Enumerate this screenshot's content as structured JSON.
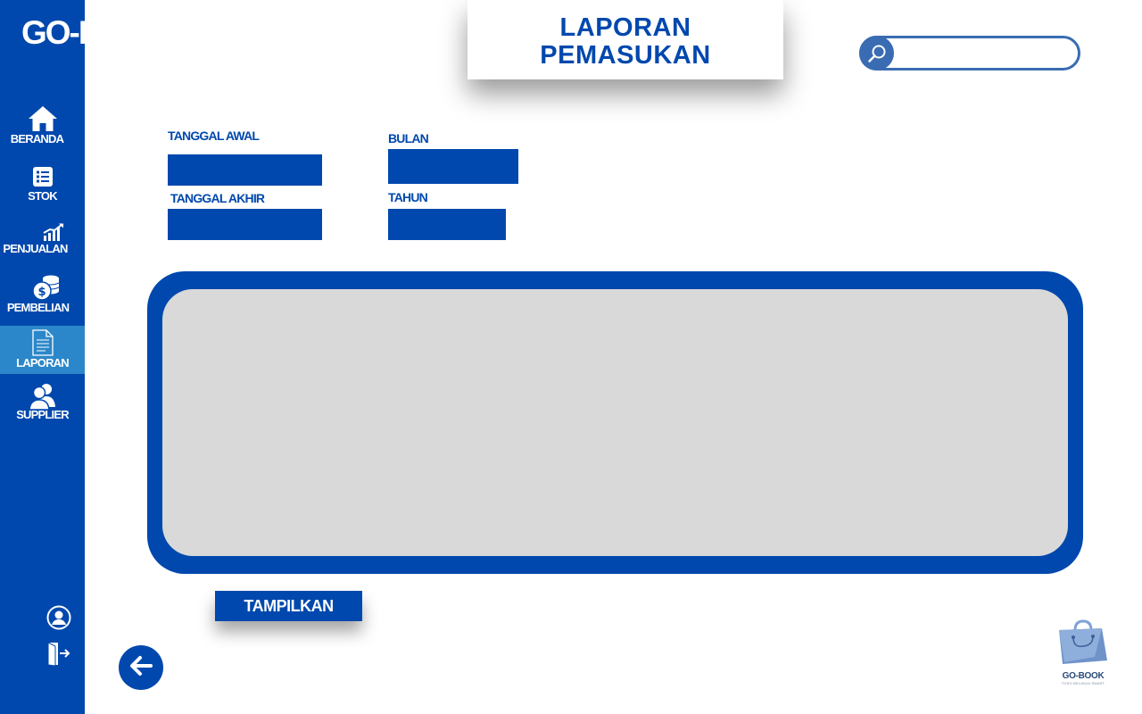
{
  "brand": {
    "name": "GO-BOOK"
  },
  "header": {
    "title_line1": "LAPORAN",
    "title_line2": "PEMASUKAN"
  },
  "search": {
    "placeholder": "",
    "value": ""
  },
  "sidebar": {
    "items": [
      {
        "label": "BERANDA",
        "icon": "home-icon",
        "active": false
      },
      {
        "label": "STOK",
        "icon": "list-icon",
        "active": false
      },
      {
        "label": "PENJUALAN",
        "icon": "chart-growth-icon",
        "active": false
      },
      {
        "label": "PEMBELIAN",
        "icon": "coins-icon",
        "active": false
      },
      {
        "label": "LAPORAN",
        "icon": "document-icon",
        "active": true
      },
      {
        "label": "SUPPLIER",
        "icon": "users-icon",
        "active": false
      }
    ],
    "bottom": [
      {
        "icon": "user-circle-icon"
      },
      {
        "icon": "logout-icon"
      }
    ]
  },
  "filters": {
    "start_date": {
      "label": "TANGGAL AWAL",
      "value": ""
    },
    "end_date": {
      "label": "TANGGAL AKHIR",
      "value": ""
    },
    "month": {
      "label": "BULAN",
      "value": ""
    },
    "year": {
      "label": "TAHUN",
      "value": ""
    }
  },
  "actions": {
    "show_label": "TAMPILKAN",
    "back_icon": "arrow-left-icon"
  },
  "footer": {
    "logo_name": "GO-BOOK",
    "logo_tagline": "TOKO BELANJA SMART",
    "logo_icon": "shopping-bag-icon"
  },
  "colors": {
    "primary": "#0048ad",
    "active": "#2b87c9",
    "panel": "#d9d9d9",
    "search_border": "#3a6cb3"
  }
}
